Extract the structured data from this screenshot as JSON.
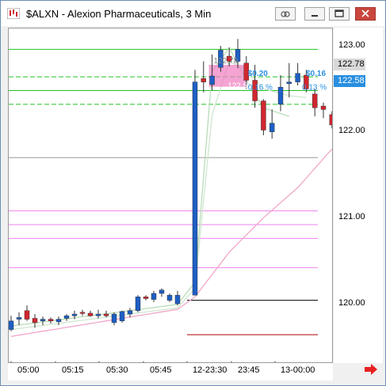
{
  "window": {
    "title": "$ALXN - Alexion Pharmaceuticals, 3 Min",
    "buttons": {
      "link": "link-icon",
      "minimize": "minimize-icon",
      "maximize": "maximize-icon",
      "close": "close-icon"
    }
  },
  "price_axis": {
    "labels": [
      "123.00",
      "122.00",
      "121.00",
      "120.00"
    ],
    "last_price_tag": "122.78",
    "current_price_tag": "122.58"
  },
  "time_axis": {
    "labels": [
      "05:00",
      "05:15",
      "05:30",
      "05:45",
      "12-23:30",
      "23:45",
      "13-00:00"
    ]
  },
  "annotations": {
    "label_top_left": "122.78",
    "label_mid_left": "122.58",
    "change_1": "$0.20",
    "change_1_pct": "0.16 %",
    "change_2": "$0.16",
    "change_2_pct": "0.13 %"
  },
  "colors": {
    "up": "#1f5fc4",
    "down": "#d0262f",
    "green_line": "#22c322",
    "pink_line": "#ee82ee",
    "accent_blue": "#2a8fe0",
    "current_tag_bg": "#2a8fe0",
    "scroll_arrow": "#e82020"
  },
  "chart_data": {
    "type": "candlestick",
    "title": "$ALXN - Alexion Pharmaceuticals, 3 Min",
    "ylim": [
      119.5,
      123.2
    ],
    "y_ticks": [
      123.0,
      122.0,
      121.0,
      120.0
    ],
    "x_ticks": [
      "05:00",
      "05:15",
      "05:30",
      "05:45",
      "12-23:30",
      "23:45",
      "13-00:00"
    ],
    "candles": [
      {
        "o": 119.7,
        "h": 119.86,
        "l": 119.68,
        "c": 119.8
      },
      {
        "o": 119.82,
        "h": 119.9,
        "l": 119.75,
        "c": 119.84
      },
      {
        "o": 119.92,
        "h": 119.98,
        "l": 119.8,
        "c": 119.82
      },
      {
        "o": 119.83,
        "h": 119.88,
        "l": 119.72,
        "c": 119.78
      },
      {
        "o": 119.8,
        "h": 119.85,
        "l": 119.75,
        "c": 119.82
      },
      {
        "o": 119.82,
        "h": 119.84,
        "l": 119.77,
        "c": 119.8
      },
      {
        "o": 119.79,
        "h": 119.85,
        "l": 119.75,
        "c": 119.82
      },
      {
        "o": 119.83,
        "h": 119.88,
        "l": 119.8,
        "c": 119.86
      },
      {
        "o": 119.86,
        "h": 119.92,
        "l": 119.82,
        "c": 119.88
      },
      {
        "o": 119.9,
        "h": 119.93,
        "l": 119.86,
        "c": 119.89
      },
      {
        "o": 119.89,
        "h": 119.92,
        "l": 119.85,
        "c": 119.86
      },
      {
        "o": 119.86,
        "h": 119.93,
        "l": 119.83,
        "c": 119.88
      },
      {
        "o": 119.88,
        "h": 119.92,
        "l": 119.84,
        "c": 119.86
      },
      {
        "o": 119.78,
        "h": 119.9,
        "l": 119.75,
        "c": 119.88
      },
      {
        "o": 119.8,
        "h": 119.92,
        "l": 119.78,
        "c": 119.91
      },
      {
        "o": 119.88,
        "h": 119.95,
        "l": 119.84,
        "c": 119.92
      },
      {
        "o": 119.92,
        "h": 120.1,
        "l": 119.9,
        "c": 120.08
      },
      {
        "o": 120.08,
        "h": 120.1,
        "l": 120.04,
        "c": 120.06
      },
      {
        "o": 120.05,
        "h": 120.15,
        "l": 120.02,
        "c": 120.12
      },
      {
        "o": 120.12,
        "h": 120.18,
        "l": 120.08,
        "c": 120.16
      },
      {
        "o": 120.04,
        "h": 120.12,
        "l": 120.02,
        "c": 120.1
      },
      {
        "o": 120.0,
        "h": 120.15,
        "l": 119.98,
        "c": 120.1
      },
      {
        "o": 120.1,
        "h": 122.72,
        "l": 121.44,
        "c": 122.58
      },
      {
        "o": 122.62,
        "h": 122.82,
        "l": 122.46,
        "c": 122.58
      },
      {
        "o": 122.55,
        "h": 122.9,
        "l": 122.48,
        "c": 122.65
      },
      {
        "o": 122.75,
        "h": 123.0,
        "l": 122.7,
        "c": 122.95
      },
      {
        "o": 122.88,
        "h": 122.98,
        "l": 122.76,
        "c": 122.82
      },
      {
        "o": 122.82,
        "h": 123.08,
        "l": 122.74,
        "c": 122.96
      },
      {
        "o": 122.8,
        "h": 122.88,
        "l": 122.5,
        "c": 122.6
      },
      {
        "o": 122.6,
        "h": 122.78,
        "l": 122.28,
        "c": 122.36
      },
      {
        "o": 122.36,
        "h": 122.38,
        "l": 121.96,
        "c": 122.02
      },
      {
        "o": 122.0,
        "h": 122.26,
        "l": 121.92,
        "c": 122.1
      },
      {
        "o": 122.32,
        "h": 122.66,
        "l": 122.24,
        "c": 122.52
      },
      {
        "o": 122.56,
        "h": 122.8,
        "l": 122.4,
        "c": 122.58
      },
      {
        "o": 122.58,
        "h": 122.8,
        "l": 122.54,
        "c": 122.68
      },
      {
        "o": 122.66,
        "h": 122.72,
        "l": 122.46,
        "c": 122.5
      },
      {
        "o": 122.44,
        "h": 122.5,
        "l": 122.18,
        "c": 122.28
      },
      {
        "o": 122.3,
        "h": 122.34,
        "l": 122.16,
        "c": 122.26
      },
      {
        "o": 122.2,
        "h": 122.24,
        "l": 122.04,
        "c": 122.08
      }
    ],
    "horizontal_levels": [
      {
        "price": 122.96,
        "color": "#22c322",
        "style": "solid"
      },
      {
        "price": 122.64,
        "color": "#22c322",
        "style": "dashed"
      },
      {
        "price": 122.48,
        "color": "#22c322",
        "style": "solid"
      },
      {
        "price": 122.32,
        "color": "#22c322",
        "style": "dashed"
      },
      {
        "price": 121.7,
        "color": "#9a9a9a",
        "style": "solid"
      },
      {
        "price": 121.08,
        "color": "#ee82ee",
        "style": "solid"
      },
      {
        "price": 120.92,
        "color": "#ee82ee",
        "style": "solid"
      },
      {
        "price": 120.76,
        "color": "#ee82ee",
        "style": "solid"
      },
      {
        "price": 120.42,
        "color": "#ee82ee",
        "style": "solid"
      },
      {
        "price": 120.04,
        "color": "#000000",
        "style": "solid"
      },
      {
        "price": 119.64,
        "color": "#b00000",
        "style": "solid"
      }
    ]
  }
}
